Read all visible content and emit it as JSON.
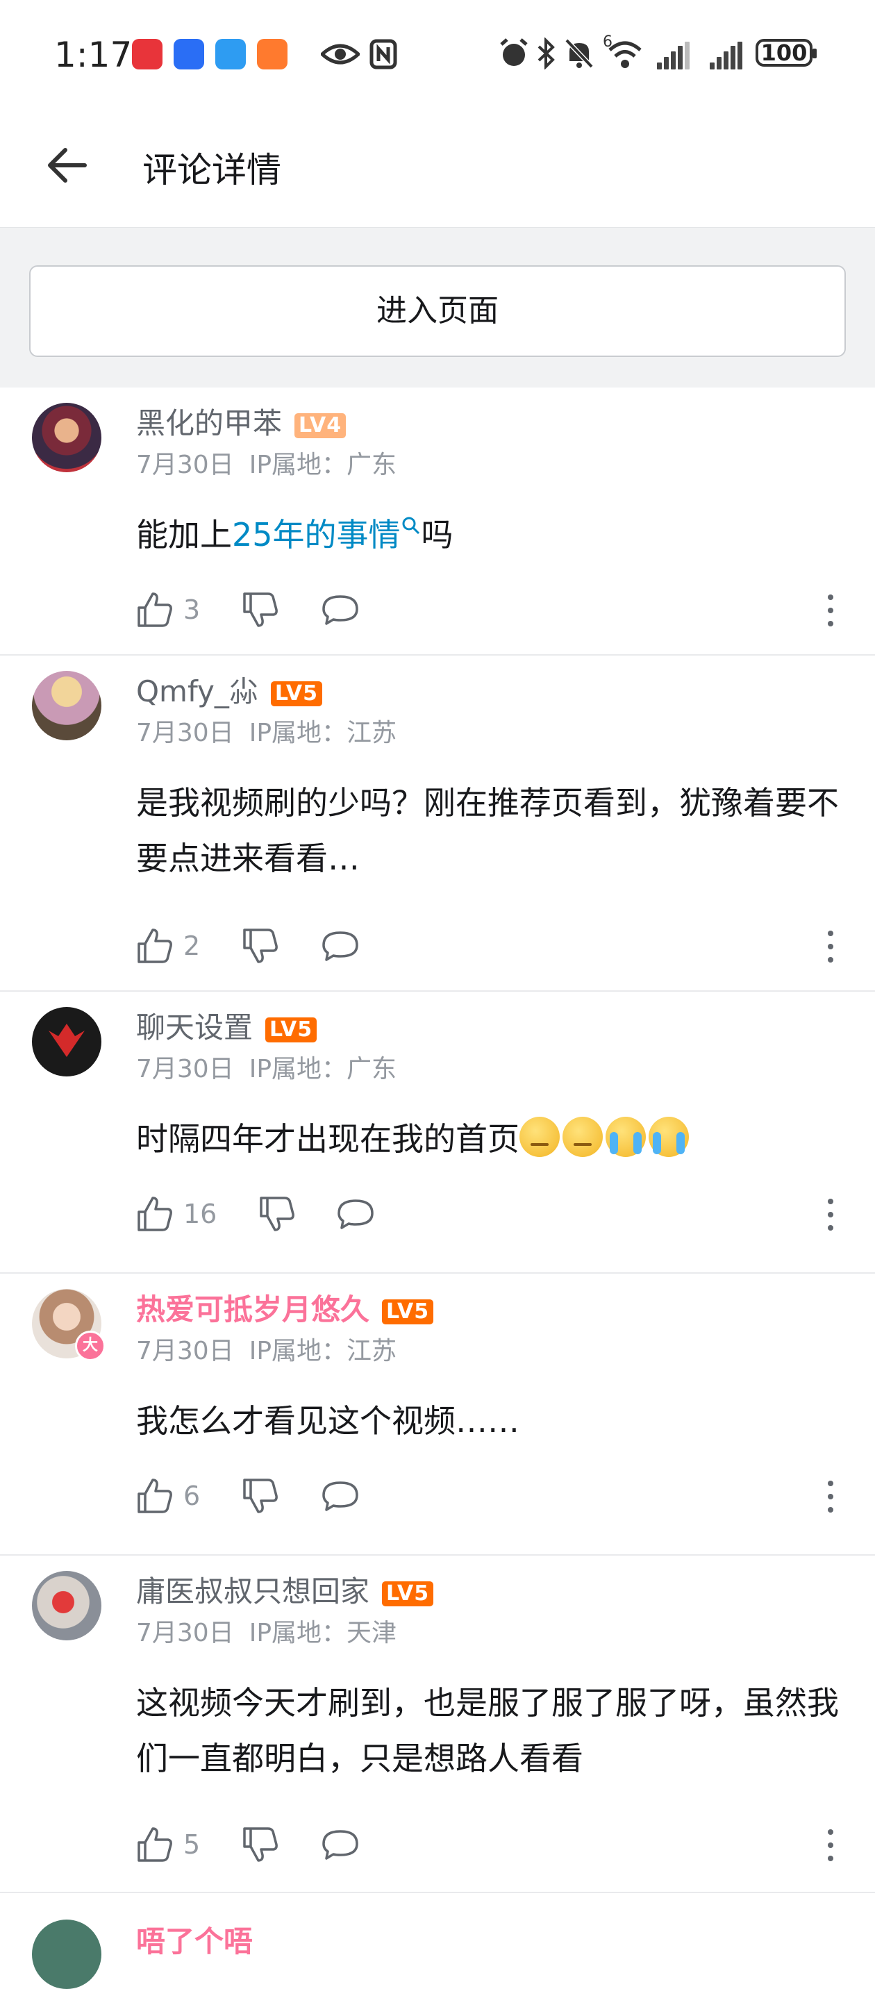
{
  "status_bar": {
    "time": "1:17",
    "app_icons": [
      "huawei-icon",
      "browser-icon",
      "message-icon",
      "app-icon"
    ],
    "status_icons": [
      "eye-icon",
      "nfc-icon",
      "alarm-icon",
      "bluetooth-icon",
      "mute-icon",
      "wifi-icon",
      "signal-icon",
      "signal-icon"
    ],
    "wifi_label": "6",
    "battery": "100"
  },
  "header": {
    "title": "评论详情",
    "back_icon": "back-arrow-icon"
  },
  "enter_button": "进入页面",
  "comments": [
    {
      "username": "黑化的甲苯",
      "level": "LV4",
      "date": "7月30日",
      "ip": "IP属地：广东",
      "text_before": "能加上",
      "link": "25年的事情",
      "text_after": "吗",
      "likes": "3"
    },
    {
      "username": "Qmfy_尛",
      "level": "LV5",
      "date": "7月30日",
      "ip": "IP属地：江苏",
      "text": "是我视频刷的少吗？刚在推荐页看到，犹豫着要不要点进来看看…",
      "likes": "2"
    },
    {
      "username": "聊天设置",
      "level": "LV5",
      "date": "7月30日",
      "ip": "IP属地：广东",
      "text": "时隔四年才出现在我的首页",
      "emojis": [
        "pensive-emoji",
        "pensive-emoji",
        "crying-emoji",
        "crying-emoji"
      ],
      "likes": "16"
    },
    {
      "username": "热爱可抵岁月悠久",
      "level": "LV5",
      "date": "7月30日",
      "ip": "IP属地：江苏",
      "text": "我怎么才看见这个视频……",
      "likes": "6",
      "badge": "大"
    },
    {
      "username": "庸医叔叔只想回家",
      "level": "LV5",
      "date": "7月30日",
      "ip": "IP属地：天津",
      "text": "这视频今天才刷到，也是服了服了服了呀，虽然我们一直都明白，只是想路人看看",
      "likes": "5"
    }
  ],
  "partial_next_username": "唔了个唔"
}
